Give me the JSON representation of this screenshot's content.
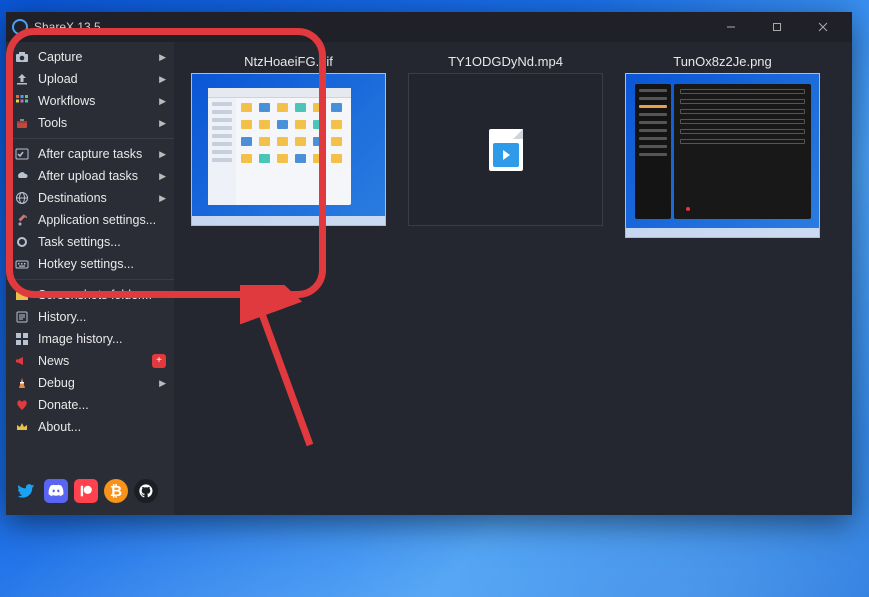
{
  "app": {
    "title": "ShareX 13.5"
  },
  "windowControls": {
    "min": "min",
    "max": "max",
    "close": "close"
  },
  "sidebar": {
    "groups": [
      {
        "items": [
          {
            "icon": "capture",
            "label": "Capture",
            "sub": true
          },
          {
            "icon": "upload",
            "label": "Upload",
            "sub": true
          },
          {
            "icon": "workflows",
            "label": "Workflows",
            "sub": true
          },
          {
            "icon": "tools",
            "label": "Tools",
            "sub": true
          }
        ]
      },
      {
        "items": [
          {
            "icon": "after-capture",
            "label": "After capture tasks",
            "sub": true
          },
          {
            "icon": "after-upload",
            "label": "After upload tasks",
            "sub": true
          },
          {
            "icon": "destinations",
            "label": "Destinations",
            "sub": true
          },
          {
            "icon": "app-settings",
            "label": "Application settings..."
          },
          {
            "icon": "task-settings",
            "label": "Task settings..."
          },
          {
            "icon": "hotkey-settings",
            "label": "Hotkey settings..."
          }
        ]
      },
      {
        "items": [
          {
            "icon": "folder",
            "label": "Screenshots folder..."
          },
          {
            "icon": "history",
            "label": "History..."
          },
          {
            "icon": "image-history",
            "label": "Image history..."
          },
          {
            "icon": "news",
            "label": "News",
            "badge": "+"
          },
          {
            "icon": "debug",
            "label": "Debug",
            "sub": true
          },
          {
            "icon": "donate",
            "label": "Donate..."
          },
          {
            "icon": "about",
            "label": "About..."
          }
        ]
      }
    ],
    "footer": [
      "twitter",
      "discord",
      "patreon",
      "bitcoin",
      "github"
    ]
  },
  "thumbnails": [
    {
      "name": "NtzHoaeiFG.gif",
      "kind": "explorer"
    },
    {
      "name": "TY1ODGDyNd.mp4",
      "kind": "video"
    },
    {
      "name": "TunOx8z2Je.png",
      "kind": "settings"
    }
  ],
  "colors": {
    "accent_red": "#e0393e",
    "twitter": "#1da1f2",
    "discord": "#5865f2",
    "patreon": "#ff424d",
    "bitcoin": "#f7931a",
    "github": "#1b1f23"
  }
}
